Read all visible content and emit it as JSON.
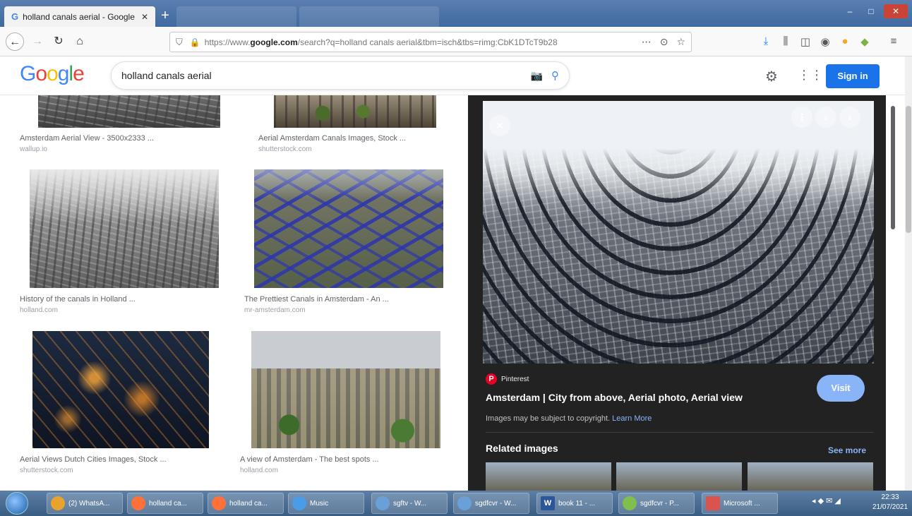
{
  "browser": {
    "active_tab": {
      "title": "holland canals aerial - Google",
      "favicon": "G"
    },
    "new_tab_symbol": "+",
    "window_controls": [
      "–",
      "□",
      "✕"
    ],
    "url_prefix": "https://www.",
    "url_host": "google.com",
    "url_rest": "/search?q=holland canals aerial&tbm=isch&tbs=rimg:CbK1DTcT9b28",
    "url_actions": [
      "⋯",
      "⊙",
      "☆"
    ]
  },
  "google": {
    "logo": [
      "G",
      "o",
      "o",
      "g",
      "l",
      "e"
    ],
    "search_query": "holland canals aerial",
    "signin_label": "Sign in"
  },
  "results": [
    {
      "title": "Amsterdam Aerial View - 3500x2333 ...",
      "domain": "wallup.io",
      "style": "aerial1"
    },
    {
      "title": "Aerial Amsterdam Canals Images, Stock ...",
      "domain": "shutterstock.com",
      "style": "aerial2"
    },
    {
      "title": "History of the canals in Holland ...",
      "domain": "holland.com",
      "style": "hazy"
    },
    {
      "title": "The Prettiest Canals in Amsterdam - An ...",
      "domain": "mr-amsterdam.com",
      "style": "canalsblue"
    },
    {
      "title": "Aerial Views Dutch Cities Images, Stock ...",
      "domain": "shutterstock.com",
      "style": "night"
    },
    {
      "title": "A view of Amsterdam - The best spots ...",
      "domain": "holland.com",
      "style": "cityday"
    }
  ],
  "preview": {
    "source": "Pinterest",
    "title": "Amsterdam | City from above, Aerial photo, Aerial view",
    "copyright_text": "Images may be subject to copyright.",
    "learn_more": "Learn More",
    "visit_label": "Visit",
    "related_label": "Related images",
    "see_more_label": "See more"
  },
  "taskbar": {
    "items": [
      {
        "label": "(2) WhatsA...",
        "icon_color": "#e8a32c"
      },
      {
        "label": "holland ca...",
        "icon_color": "#ff7139"
      },
      {
        "label": "holland ca...",
        "icon_color": "#ff7139"
      },
      {
        "label": "Music",
        "icon_color": "#4a9be8"
      },
      {
        "label": "sgftv - W...",
        "icon_color": "#6aa0d8"
      },
      {
        "label": "sgdfcvr - W...",
        "icon_color": "#6aa0d8"
      },
      {
        "label": "book 11 - ...",
        "icon_color": "#2b579a",
        "icon_text": "W"
      },
      {
        "label": "sgdfcvr - P...",
        "icon_color": "#7fbf4d"
      },
      {
        "label": "Microsoft ...",
        "icon_color": "#d9534f"
      }
    ],
    "time": "22:33",
    "date": "21/07/2021"
  }
}
